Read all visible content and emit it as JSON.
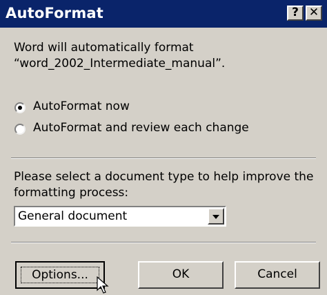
{
  "window": {
    "title": "AutoFormat",
    "help_glyph": "?",
    "close_glyph": "✕"
  },
  "message": {
    "line1": "Word will automatically format",
    "line2": "“word_2002_Intermediate_manual”."
  },
  "options": [
    {
      "label": "AutoFormat now",
      "selected": true
    },
    {
      "label": "AutoFormat and review each change",
      "selected": false
    }
  ],
  "doc_type": {
    "prompt_line1": "Please select a document type to help improve the",
    "prompt_line2": "formatting process:",
    "selected": "General document"
  },
  "buttons": {
    "options": "Options...",
    "ok": "OK",
    "cancel": "Cancel"
  },
  "colors": {
    "titlebar": "#0a246a",
    "face": "#d4d0c8"
  }
}
